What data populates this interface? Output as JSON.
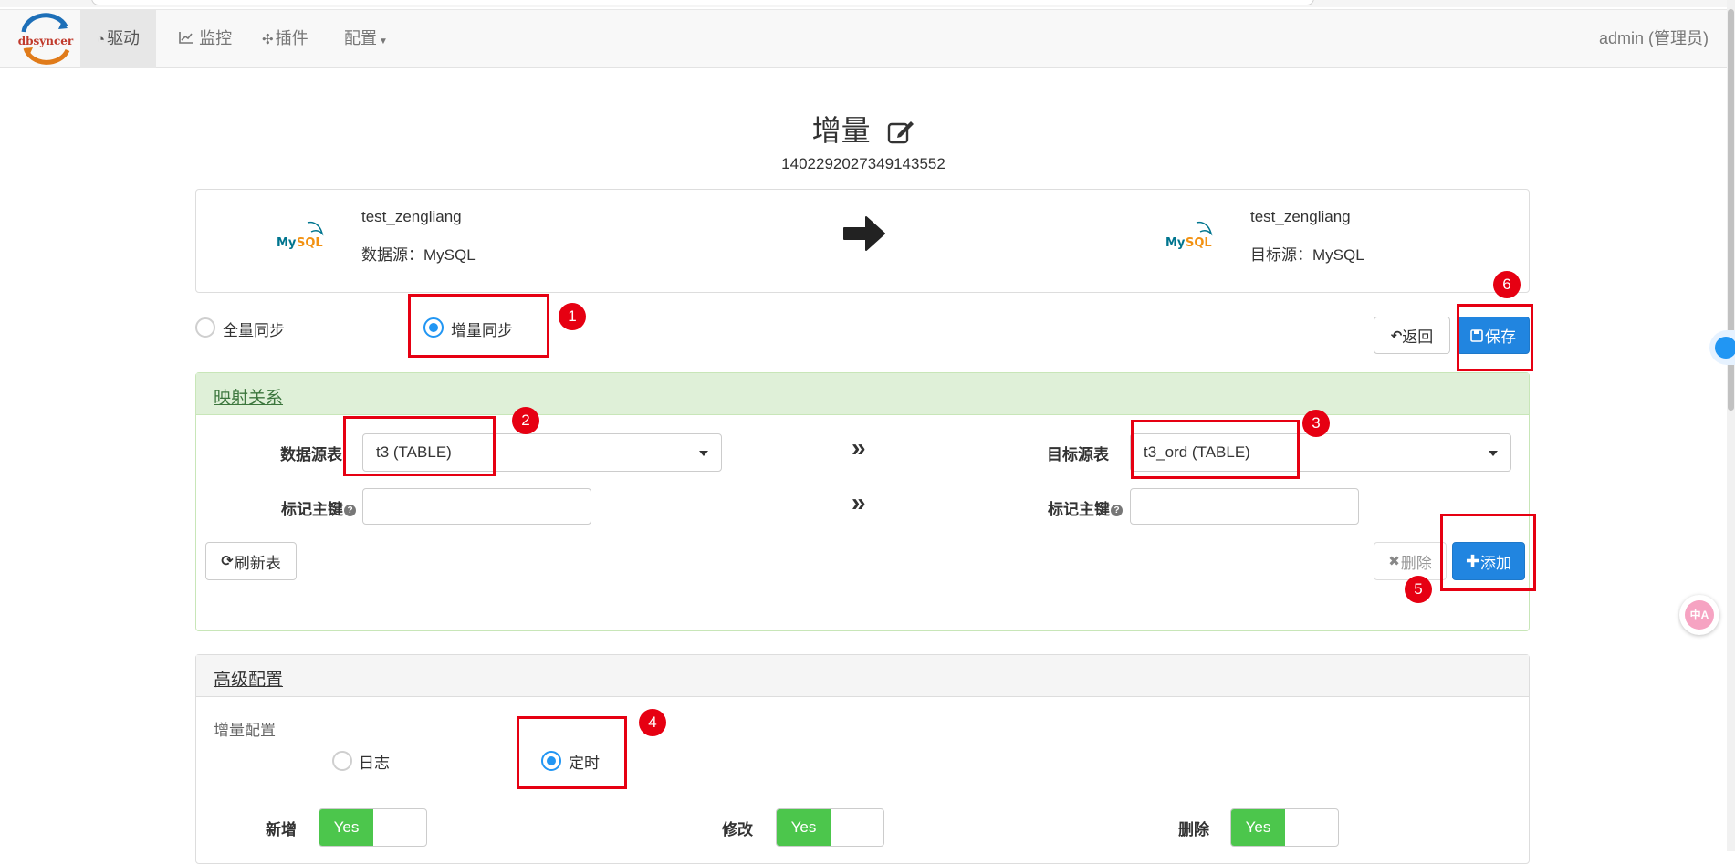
{
  "navbar": {
    "logo_text": "dbsyncer",
    "items": [
      {
        "label": "驱动",
        "icon": "dashboard-icon"
      },
      {
        "label": "监控",
        "icon": "line-chart-icon"
      },
      {
        "label": "插件",
        "icon": "puzzle-icon"
      },
      {
        "label": "配置",
        "icon": "caret-down-icon"
      }
    ],
    "user": "admin (管理员)"
  },
  "header": {
    "title": "增量",
    "id": "1402292027349143552"
  },
  "connection": {
    "source": {
      "name": "test_zengliang",
      "type": "数据源：MySQL",
      "logo_text": "MySQL"
    },
    "target": {
      "name": "test_zengliang",
      "type": "目标源：MySQL",
      "logo_text": "MySQL"
    }
  },
  "sync_mode": {
    "options": [
      "全量同步",
      "增量同步"
    ],
    "selected": "增量同步"
  },
  "actions": {
    "back_label": "返回",
    "save_label": "保存"
  },
  "mapping": {
    "title": "映射关系",
    "source_table_label": "数据源表",
    "source_table_value": "t3 (TABLE)",
    "target_table_label": "目标源表",
    "target_table_value": "t3_ord (TABLE)",
    "source_pk_label": "标记主键",
    "target_pk_label": "标记主键",
    "source_pk_value": "",
    "target_pk_value": "",
    "refresh_label": "刷新表",
    "delete_label": "删除",
    "add_label": "添加"
  },
  "advanced": {
    "title": "高级配置",
    "incr_label": "增量配置",
    "incr_options": [
      "日志",
      "定时"
    ],
    "incr_selected": "定时",
    "toggles": [
      {
        "label": "新增",
        "value": "Yes"
      },
      {
        "label": "修改",
        "value": "Yes"
      },
      {
        "label": "删除",
        "value": "Yes"
      }
    ]
  },
  "annotations": [
    "1",
    "2",
    "3",
    "4",
    "5",
    "6"
  ],
  "colors": {
    "primary": "#2185e0",
    "success_bg": "#dff0d8",
    "success_text": "#3c763d",
    "toggle_on": "#4cc64c",
    "annotation_red": "#e60012",
    "radio_on": "#2196f3"
  }
}
